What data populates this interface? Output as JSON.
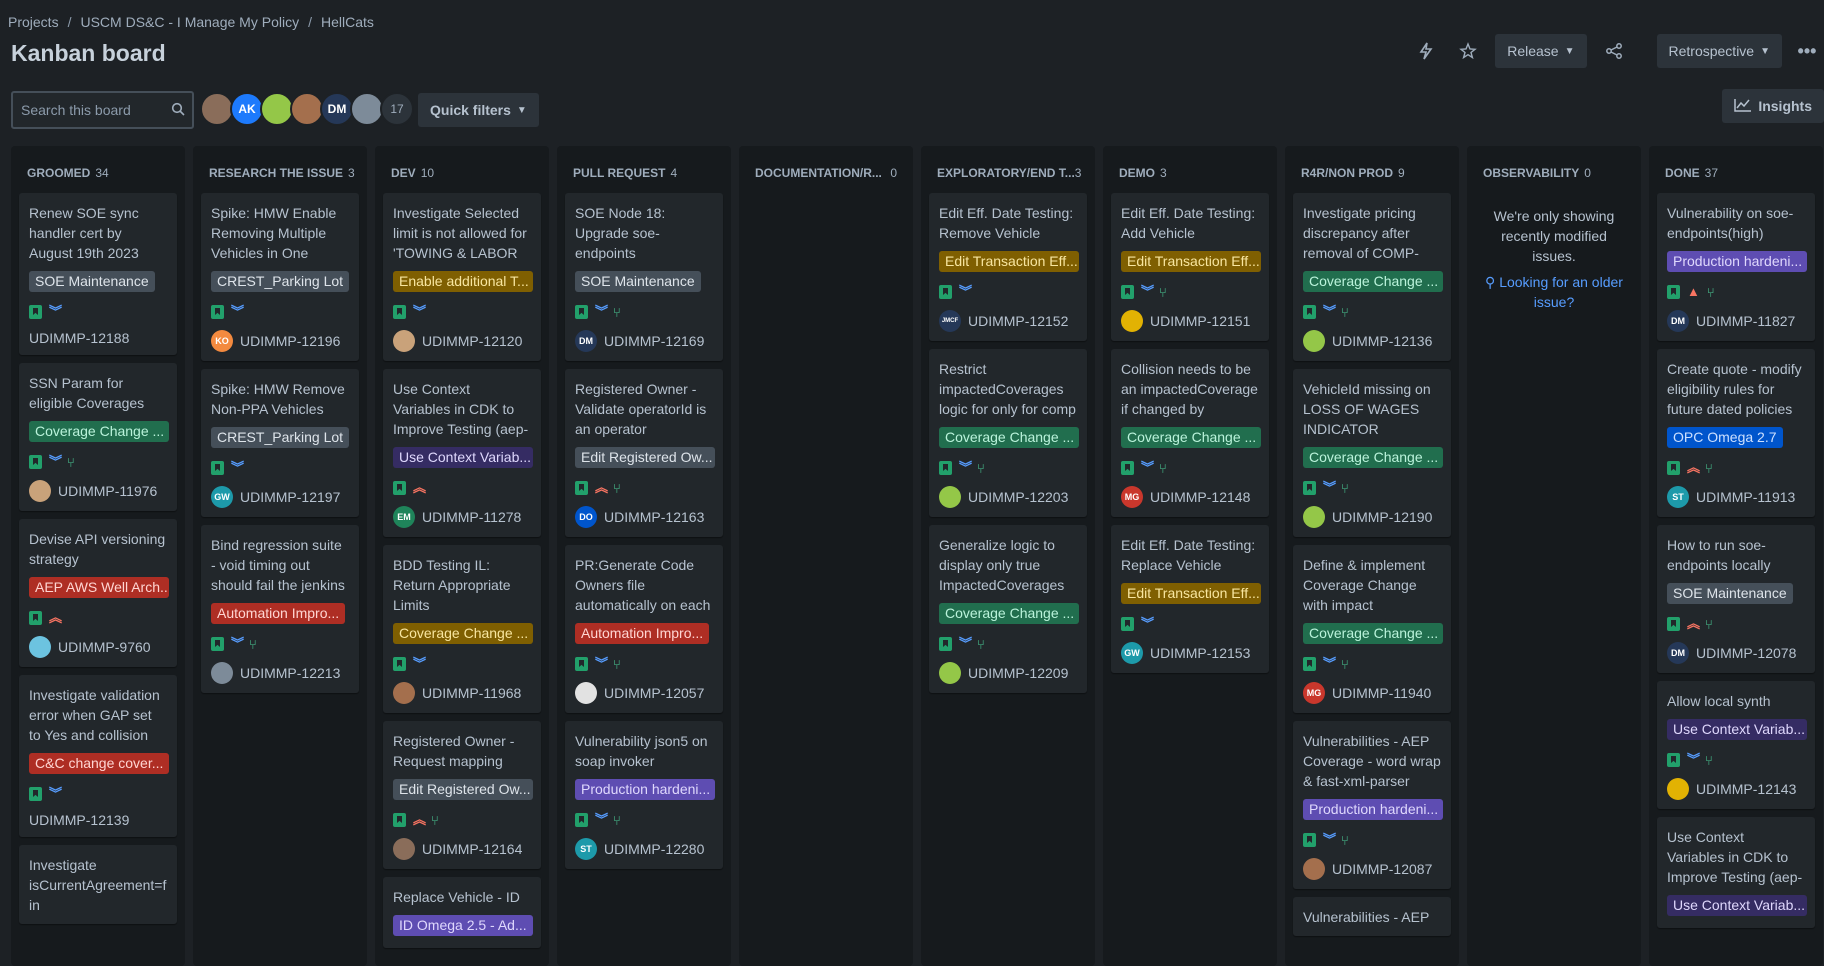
{
  "breadcrumb": [
    "Projects",
    "USCM DS&C - I Manage My Policy",
    "HellCats"
  ],
  "page_title": "Kanban board",
  "toolbar": {
    "release_label": "Release",
    "retro_label": "Retrospective",
    "quick_filters_label": "Quick filters",
    "insights_label": "Insights"
  },
  "search": {
    "placeholder": "Search this board"
  },
  "avatars": [
    {
      "initials": "",
      "color": "#8a6d5a"
    },
    {
      "initials": "AK",
      "color": "#1d7afc"
    },
    {
      "initials": "",
      "color": "#94c748"
    },
    {
      "initials": "",
      "color": "#a46f4d"
    },
    {
      "initials": "DM",
      "color": "#253858"
    },
    {
      "initials": "",
      "color": "#7d8b99"
    }
  ],
  "avatar_more": "17",
  "columns": [
    {
      "name": "GROOMED",
      "count": "34",
      "cards": [
        {
          "summary": "Renew SOE sync handler cert by August 19th 2023",
          "epic": "SOE Maintenance",
          "epic_bg": "#454f59",
          "epic_fg": "#dee4ea",
          "prio": "low",
          "branch": false,
          "key": "UDIMMP-12188",
          "av": "",
          "av_color": ""
        },
        {
          "summary": "SSN Param for eligible Coverages",
          "epic": "Coverage Change ...",
          "epic_bg": "#216e4e",
          "epic_fg": "#baf3db",
          "prio": "low",
          "branch": true,
          "key": "UDIMMP-11976",
          "av": "",
          "av_color": "#c9a27a"
        },
        {
          "summary": "Devise API versioning strategy",
          "epic": "AEP AWS Well Arch...",
          "epic_bg": "#ae2e24",
          "epic_fg": "#ffd5d2",
          "prio": "high",
          "branch": false,
          "key": "UDIMMP-9760",
          "av": "",
          "av_color": "#6cc3e0"
        },
        {
          "summary": "Investigate validation error when GAP set to Yes and collision set to",
          "epic": "C&C change cover...",
          "epic_bg": "#ae2e24",
          "epic_fg": "#ffd5d2",
          "prio": "low",
          "branch": false,
          "key": "UDIMMP-12139",
          "av": "",
          "av_color": ""
        },
        {
          "summary": "Investigate isCurrentAgreement=fa in",
          "epic": "",
          "epic_bg": "",
          "epic_fg": "",
          "prio": "",
          "branch": false,
          "key": "",
          "av": "",
          "av_color": ""
        }
      ]
    },
    {
      "name": "RESEARCH THE ISSUE",
      "count": "3",
      "cards": [
        {
          "summary": "Spike: HMW Enable Removing Multiple Vehicles in One",
          "epic": "CREST_Parking Lot",
          "epic_bg": "#454f59",
          "epic_fg": "#dee4ea",
          "prio": "low",
          "branch": false,
          "key": "UDIMMP-12196",
          "av": "KO",
          "av_color": "#f38a3f"
        },
        {
          "summary": "Spike: HMW Remove Non-PPA Vehicles",
          "epic": "CREST_Parking Lot",
          "epic_bg": "#454f59",
          "epic_fg": "#dee4ea",
          "prio": "low",
          "branch": false,
          "key": "UDIMMP-12197",
          "av": "GW",
          "av_color": "#1d9aaa"
        },
        {
          "summary": "Bind regression suite - void timing out should fail the jenkins job",
          "epic": "Automation Impro...",
          "epic_bg": "#ae2e24",
          "epic_fg": "#ffd5d2",
          "prio": "low",
          "branch": true,
          "key": "UDIMMP-12213",
          "av": "",
          "av_color": "#7d8b99"
        }
      ]
    },
    {
      "name": "DEV",
      "count": "10",
      "cards": [
        {
          "summary": "Investigate Selected limit is not allowed for 'TOWING & LABOR",
          "epic": "Enable additional T...",
          "epic_bg": "#7f5f01",
          "epic_fg": "#f8e6a0",
          "prio": "low",
          "branch": false,
          "key": "UDIMMP-12120",
          "av": "",
          "av_color": "#c9a27a"
        },
        {
          "summary": "Use Context Variables in CDK to Improve Testing (aep-mock-",
          "epic": "Use Context Variab...",
          "epic_bg": "#352c63",
          "epic_fg": "#dfd8fd",
          "prio": "high",
          "branch": false,
          "key": "UDIMMP-11278",
          "av": "EM",
          "av_color": "#1f845a"
        },
        {
          "summary": "BDD Testing IL: Return Appropriate Limits",
          "epic": "Coverage Change ...",
          "epic_bg": "#7f5f01",
          "epic_fg": "#f8e6a0",
          "prio": "low",
          "branch": false,
          "key": "UDIMMP-11968",
          "av": "",
          "av_color": "#a46f4d"
        },
        {
          "summary": "Registered Owner - Request mapping",
          "epic": "Edit Registered Ow...",
          "epic_bg": "#454f59",
          "epic_fg": "#dee4ea",
          "prio": "high",
          "branch": true,
          "key": "UDIMMP-12164",
          "av": "",
          "av_color": "#8a6d5a"
        },
        {
          "summary": "Replace Vehicle - ID",
          "epic": "ID Omega 2.5 - Ad...",
          "epic_bg": "#5e4db2",
          "epic_fg": "#dfd8fd",
          "prio": "",
          "branch": false,
          "key": "",
          "av": "",
          "av_color": ""
        }
      ]
    },
    {
      "name": "PULL REQUEST",
      "count": "4",
      "cards": [
        {
          "summary": "SOE Node 18: Upgrade soe-endpoints",
          "epic": "SOE Maintenance",
          "epic_bg": "#454f59",
          "epic_fg": "#dee4ea",
          "prio": "low",
          "branch": true,
          "key": "UDIMMP-12169",
          "av": "DM",
          "av_color": "#253858"
        },
        {
          "summary": "Registered Owner - Validate operatorId is an operator",
          "epic": "Edit Registered Ow...",
          "epic_bg": "#454f59",
          "epic_fg": "#dee4ea",
          "prio": "high",
          "branch": true,
          "key": "UDIMMP-12163",
          "av": "DO",
          "av_color": "#0055cc"
        },
        {
          "summary": "PR:Generate Code Owners file automatically on each",
          "epic": "Automation Impro...",
          "epic_bg": "#ae2e24",
          "epic_fg": "#ffd5d2",
          "prio": "low",
          "branch": true,
          "key": "UDIMMP-12057",
          "av": "",
          "av_color": "#e2e2e2"
        },
        {
          "summary": "Vulnerability json5 on soap invoker",
          "epic": "Production hardeni...",
          "epic_bg": "#5e4db2",
          "epic_fg": "#dfd8fd",
          "prio": "low",
          "branch": true,
          "key": "UDIMMP-12280",
          "av": "ST",
          "av_color": "#1d9aaa"
        }
      ]
    },
    {
      "name": "DOCUMENTATION/R...",
      "count": "0",
      "cards": []
    },
    {
      "name": "EXPLORATORY/END T...",
      "count": "3",
      "cards": [
        {
          "summary": "Edit Eff. Date Testing: Remove Vehicle",
          "epic": "Edit Transaction Eff...",
          "epic_bg": "#7f5f01",
          "epic_fg": "#f8e6a0",
          "prio": "low",
          "branch": false,
          "key": "UDIMMP-12152",
          "av": "JMCF",
          "av_color": "#253858"
        },
        {
          "summary": "Restrict impactedCoverages logic for only for comp",
          "epic": "Coverage Change ...",
          "epic_bg": "#216e4e",
          "epic_fg": "#baf3db",
          "prio": "low",
          "branch": true,
          "key": "UDIMMP-12203",
          "av": "",
          "av_color": "#94c748"
        },
        {
          "summary": "Generalize logic to display only true ImpactedCoverages in",
          "epic": "Coverage Change ...",
          "epic_bg": "#216e4e",
          "epic_fg": "#baf3db",
          "prio": "low",
          "branch": true,
          "key": "UDIMMP-12209",
          "av": "",
          "av_color": "#94c748"
        }
      ]
    },
    {
      "name": "DEMO",
      "count": "3",
      "cards": [
        {
          "summary": "Edit Eff. Date Testing: Add Vehicle",
          "epic": "Edit Transaction Eff...",
          "epic_bg": "#7f5f01",
          "epic_fg": "#f8e6a0",
          "prio": "low",
          "branch": true,
          "key": "UDIMMP-12151",
          "av": "",
          "av_color": "#e2b203"
        },
        {
          "summary": "Collision needs to be an impactedCoverage if changed by",
          "epic": "Coverage Change ...",
          "epic_bg": "#216e4e",
          "epic_fg": "#baf3db",
          "prio": "low",
          "branch": true,
          "key": "UDIMMP-12148",
          "av": "MG",
          "av_color": "#c9372c"
        },
        {
          "summary": "Edit Eff. Date Testing: Replace Vehicle",
          "epic": "Edit Transaction Eff...",
          "epic_bg": "#7f5f01",
          "epic_fg": "#f8e6a0",
          "prio": "low",
          "branch": false,
          "key": "UDIMMP-12153",
          "av": "GW",
          "av_color": "#1d9aaa"
        }
      ]
    },
    {
      "name": "R4R/NON PROD",
      "count": "9",
      "cards": [
        {
          "summary": "Investigate pricing discrepancy after removal of COMP-",
          "epic": "Coverage Change ...",
          "epic_bg": "#216e4e",
          "epic_fg": "#baf3db",
          "prio": "low",
          "branch": true,
          "key": "UDIMMP-12136",
          "av": "",
          "av_color": "#94c748"
        },
        {
          "summary": "VehicleId missing on LOSS OF WAGES INDICATOR",
          "epic": "Coverage Change ...",
          "epic_bg": "#216e4e",
          "epic_fg": "#baf3db",
          "prio": "low",
          "branch": true,
          "key": "UDIMMP-12190",
          "av": "",
          "av_color": "#94c748"
        },
        {
          "summary": "Define & implement Coverage Change with impact coverages",
          "epic": "Coverage Change ...",
          "epic_bg": "#216e4e",
          "epic_fg": "#baf3db",
          "prio": "low",
          "branch": true,
          "key": "UDIMMP-11940",
          "av": "MG",
          "av_color": "#c9372c"
        },
        {
          "summary": "Vulnerabilities - AEP Coverage - word wrap & fast-xml-parser",
          "epic": "Production hardeni...",
          "epic_bg": "#5e4db2",
          "epic_fg": "#dfd8fd",
          "prio": "low",
          "branch": true,
          "key": "UDIMMP-12087",
          "av": "",
          "av_color": "#a46f4d"
        },
        {
          "summary": "Vulnerabilities - AEP",
          "epic": "",
          "epic_bg": "",
          "epic_fg": "",
          "prio": "",
          "branch": false,
          "key": "",
          "av": "",
          "av_color": ""
        }
      ]
    },
    {
      "name": "OBSERVABILITY",
      "count": "0",
      "cards": [],
      "message": "We're only showing recently modified issues.",
      "link": "Looking for an older issue?"
    },
    {
      "name": "DONE",
      "count": "37",
      "cards": [
        {
          "summary": "Vulnerability on soe-endpoints(high)",
          "epic": "Production hardeni...",
          "epic_bg": "#5e4db2",
          "epic_fg": "#dfd8fd",
          "prio": "crit",
          "branch": true,
          "key": "UDIMMP-11827",
          "av": "DM",
          "av_color": "#253858"
        },
        {
          "summary": "Create quote - modify eligibility rules for future dated policies",
          "epic": "OPC Omega 2.7",
          "epic_bg": "#0055cc",
          "epic_fg": "#cce0ff",
          "prio": "high",
          "branch": true,
          "key": "UDIMMP-11913",
          "av": "ST",
          "av_color": "#1d9aaa"
        },
        {
          "summary": "How to run soe-endpoints locally",
          "epic": "SOE Maintenance",
          "epic_bg": "#454f59",
          "epic_fg": "#dee4ea",
          "prio": "high",
          "branch": true,
          "key": "UDIMMP-12078",
          "av": "DM",
          "av_color": "#253858"
        },
        {
          "summary": "Allow local synth",
          "epic": "Use Context Variab...",
          "epic_bg": "#352c63",
          "epic_fg": "#dfd8fd",
          "prio": "low",
          "branch": true,
          "key": "UDIMMP-12143",
          "av": "",
          "av_color": "#e2b203"
        },
        {
          "summary": "Use Context Variables in CDK to Improve Testing (aep-pricing)",
          "epic": "Use Context Variab...",
          "epic_bg": "#352c63",
          "epic_fg": "#dfd8fd",
          "prio": "",
          "branch": false,
          "key": "",
          "av": "",
          "av_color": ""
        }
      ]
    }
  ],
  "colors": {
    "bg": "#1d2125",
    "column": "#161a1d",
    "card": "#22272b",
    "story": "#22a06b",
    "prio_low": "#579dff",
    "prio_high": "#f87462",
    "link": "#579dff"
  }
}
